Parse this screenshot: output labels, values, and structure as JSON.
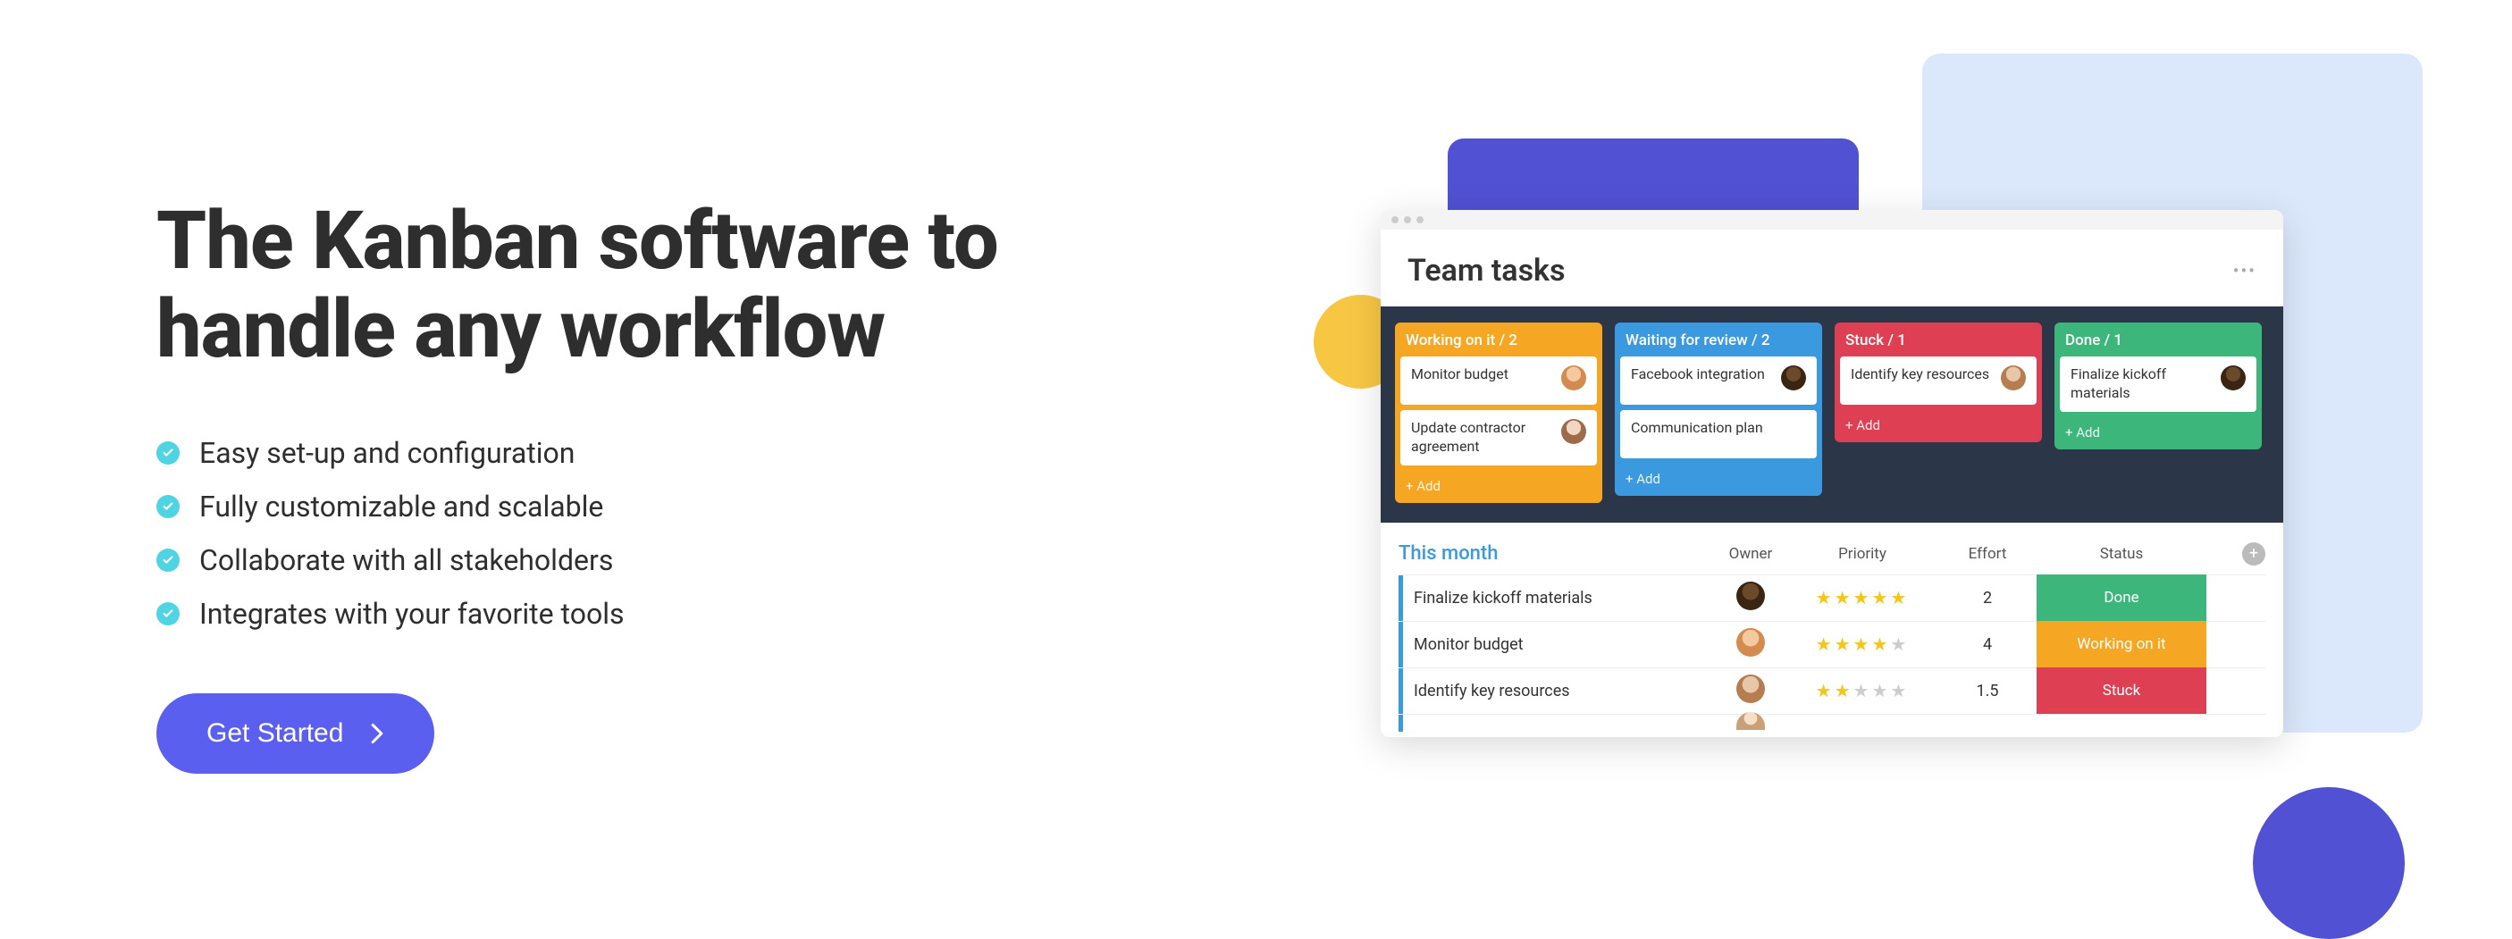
{
  "hero": {
    "title": "The Kanban software to handle any workflow",
    "features": [
      "Easy set-up and configuration",
      "Fully customizable and scalable",
      "Collaborate with all stakeholders",
      "Integrates with your favorite tools"
    ],
    "cta_label": "Get Started"
  },
  "mockup": {
    "title": "Team tasks",
    "add_label": "+ Add",
    "columns": [
      {
        "header": "Working on it / 2",
        "color": "working",
        "cards": [
          {
            "text": "Monitor budget",
            "avatar": "av1"
          },
          {
            "text": "Update contractor agreement",
            "avatar": "av3"
          }
        ]
      },
      {
        "header": "Waiting for review / 2",
        "color": "waiting",
        "cards": [
          {
            "text": "Facebook integration",
            "avatar": "av2"
          },
          {
            "text": "Communication plan",
            "avatar": ""
          }
        ]
      },
      {
        "header": "Stuck / 1",
        "color": "stuck",
        "cards": [
          {
            "text": "Identify key resources",
            "avatar": "av4"
          }
        ]
      },
      {
        "header": "Done / 1",
        "color": "done",
        "cards": [
          {
            "text": "Finalize kickoff materials",
            "avatar": "av2"
          }
        ]
      }
    ],
    "table": {
      "section": "This month",
      "headers": {
        "owner": "Owner",
        "priority": "Priority",
        "effort": "Effort",
        "status": "Status"
      },
      "rows": [
        {
          "title": "Finalize kickoff materials",
          "avatar": "av2",
          "stars": 5,
          "effort": "2",
          "status": "Done",
          "status_class": "st-done"
        },
        {
          "title": "Monitor budget",
          "avatar": "av1",
          "stars": 4,
          "effort": "4",
          "status": "Working on it",
          "status_class": "st-working"
        },
        {
          "title": "Identify key resources",
          "avatar": "av4",
          "stars": 2,
          "effort": "1.5",
          "status": "Stuck",
          "status_class": "st-stuck"
        }
      ]
    }
  }
}
